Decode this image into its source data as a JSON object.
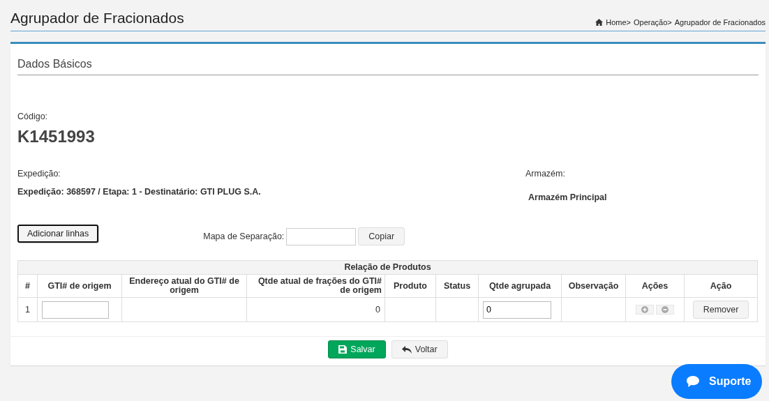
{
  "page": {
    "title": "Agrupador de Fracionados",
    "breadcrumb": [
      "Home>",
      "Operação>",
      "Agrupador de Fracionados"
    ]
  },
  "panel": {
    "title": "Dados Básicos",
    "code": {
      "label": "Código:",
      "value": "K1451993"
    },
    "expedition": {
      "label": "Expedição:",
      "value": "Expedição: 368597 / Etapa: 1 - Destinatário: GTI PLUG S.A."
    },
    "warehouse": {
      "label": "Armazém:",
      "value": "Armazém Principal"
    },
    "add_lines_button": "Adicionar linhas",
    "separation_map": {
      "label": "Mapa de Separação:",
      "button": "Copiar"
    },
    "table": {
      "title": "Relação de Produtos",
      "columns": [
        "#",
        "GTI# de origem",
        "Endereço atual do GTI# de origem",
        "Qtde atual de frações do GTI# de origem",
        "Produto",
        "Status",
        "Qtde agrupada",
        "Observação",
        "Ações",
        "Ação"
      ],
      "rows": [
        {
          "number": "1",
          "fraction_qty": "0",
          "grouped_qty": "0",
          "action": "Remover"
        }
      ]
    },
    "buttons": [
      {
        "label": "Salvar",
        "kind": "primary"
      },
      {
        "label": "Voltar",
        "kind": "back"
      }
    ]
  },
  "support_button": "Suporte"
}
